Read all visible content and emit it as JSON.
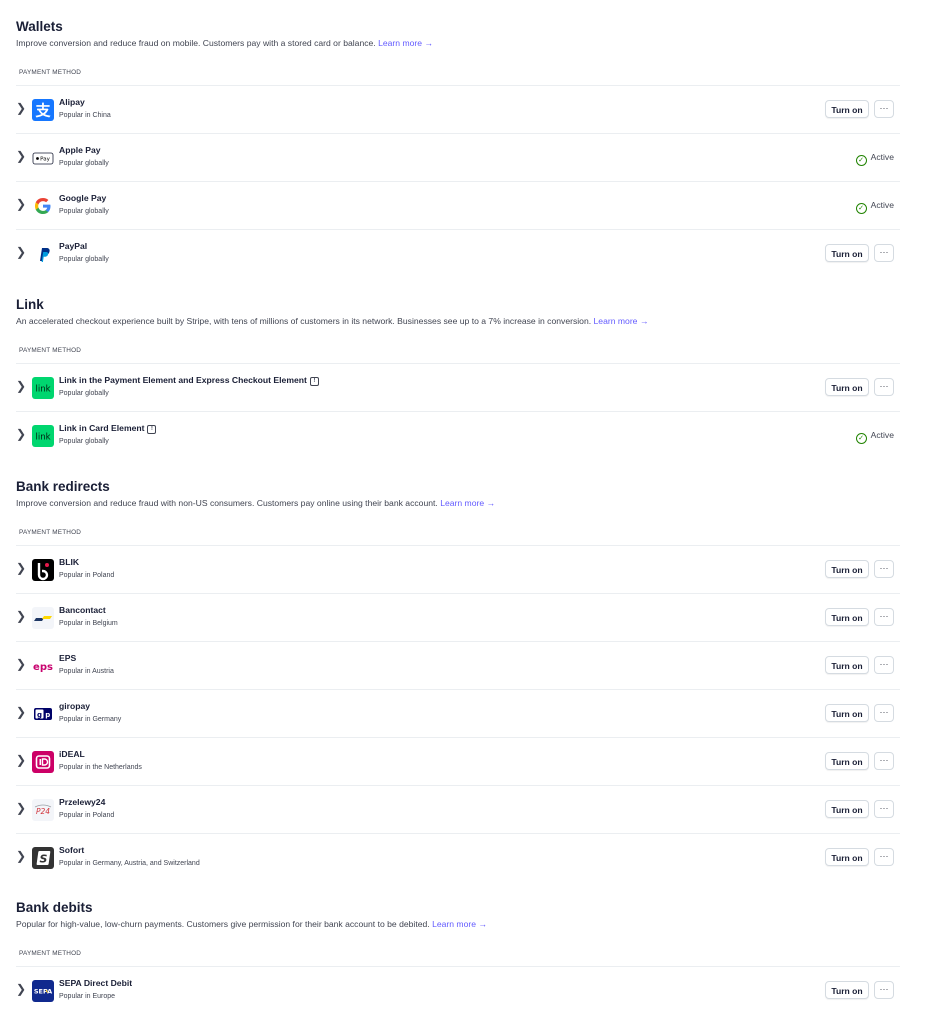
{
  "colors": {
    "accent": "#635bff",
    "active": "#228403",
    "text": "#1a1f36",
    "muted": "#414552",
    "divider": "#ebeef1"
  },
  "learn_more": "Learn more →",
  "column_header": "PAYMENT METHOD",
  "turn_on_label": "Turn on",
  "more_label": "···",
  "active_label": "Active",
  "sections": {
    "wallets": {
      "title": "Wallets",
      "description": "Improve conversion and reduce fraud on mobile. Customers pay with a stored card or balance.",
      "items": [
        {
          "name": "Alipay",
          "sub": "Popular in China",
          "status": "off",
          "icon": "alipay-logo"
        },
        {
          "name": "Apple Pay",
          "sub": "Popular globally",
          "status": "active",
          "icon": "apple-pay-logo"
        },
        {
          "name": "Google Pay",
          "sub": "Popular globally",
          "status": "active",
          "icon": "google-logo"
        },
        {
          "name": "PayPal",
          "sub": "Popular globally",
          "status": "off",
          "icon": "paypal-logo"
        }
      ]
    },
    "link": {
      "title": "Link",
      "description": "An accelerated checkout experience built by Stripe, with tens of millions of customers in its network. Businesses see up to a 7% increase in conversion.",
      "items": [
        {
          "name": "Link in the Payment Element and Express Checkout Element",
          "sub": "Popular globally",
          "status": "off",
          "icon": "link-logo",
          "info": true
        },
        {
          "name": "Link in Card Element",
          "sub": "Popular globally",
          "status": "active",
          "icon": "link-logo",
          "info": true
        }
      ]
    },
    "bank_redirects": {
      "title": "Bank redirects",
      "description": "Improve conversion and reduce fraud with non-US consumers. Customers pay online using their bank account.",
      "items": [
        {
          "name": "BLIK",
          "sub": "Popular in Poland",
          "status": "off",
          "icon": "blik-logo"
        },
        {
          "name": "Bancontact",
          "sub": "Popular in Belgium",
          "status": "off",
          "icon": "bancontact-logo"
        },
        {
          "name": "EPS",
          "sub": "Popular in Austria",
          "status": "off",
          "icon": "eps-logo"
        },
        {
          "name": "giropay",
          "sub": "Popular in Germany",
          "status": "off",
          "icon": "giropay-logo"
        },
        {
          "name": "iDEAL",
          "sub": "Popular in the Netherlands",
          "status": "off",
          "icon": "ideal-logo"
        },
        {
          "name": "Przelewy24",
          "sub": "Popular in Poland",
          "status": "off",
          "icon": "przelewy24-logo"
        },
        {
          "name": "Sofort",
          "sub": "Popular in Germany, Austria, and Switzerland",
          "status": "off",
          "icon": "sofort-logo"
        }
      ]
    },
    "bank_debits": {
      "title": "Bank debits",
      "description": "Popular for high-value, low-churn payments. Customers give permission for their bank account to be debited.",
      "items": [
        {
          "name": "SEPA Direct Debit",
          "sub": "Popular in Europe",
          "status": "off",
          "icon": "sepa-logo"
        }
      ]
    }
  }
}
